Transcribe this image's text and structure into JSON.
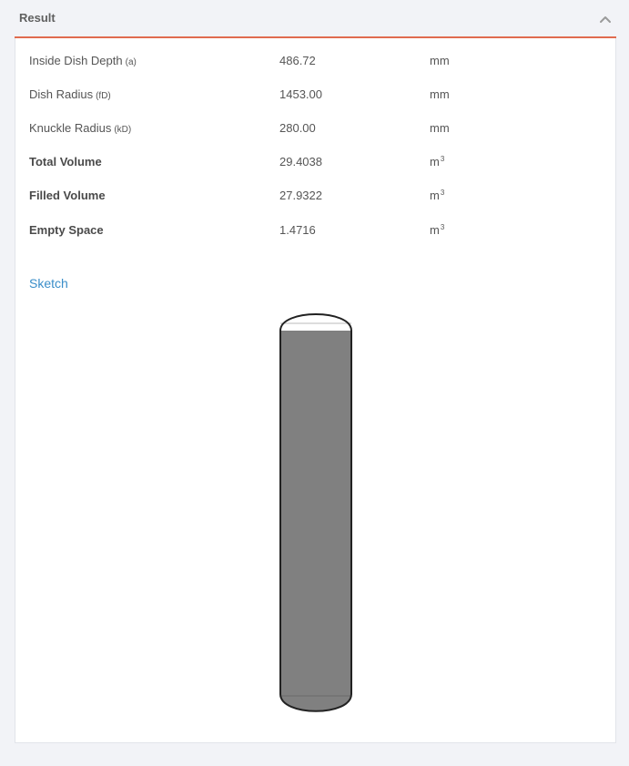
{
  "panel": {
    "title": "Result",
    "collapse_icon": "chevron-up-icon"
  },
  "results": [
    {
      "label": "Inside Dish Depth",
      "symbol": "(a)",
      "value": "486.72",
      "unit": "mm",
      "unit_sup": ""
    },
    {
      "label": "Dish Radius",
      "symbol": "(fD)",
      "value": "1453.00",
      "unit": "mm",
      "unit_sup": ""
    },
    {
      "label": "Knuckle Radius",
      "symbol": "(kD)",
      "value": "280.00",
      "unit": "mm",
      "unit_sup": ""
    },
    {
      "label": "Total Volume",
      "symbol": "",
      "value": "29.4038",
      "unit": "m",
      "unit_sup": "3"
    },
    {
      "label": "Filled Volume",
      "symbol": "",
      "value": "27.9322",
      "unit": "m",
      "unit_sup": "3"
    },
    {
      "label": "Empty Space",
      "symbol": "",
      "value": "1.4716",
      "unit": "m",
      "unit_sup": "3"
    }
  ],
  "sketch": {
    "title": "Sketch",
    "fill_level": 0.95,
    "fill_color": "#808080",
    "outline_color": "#222222"
  },
  "colors": {
    "accent_line": "#e06b4f",
    "link": "#3a8ec9",
    "background": "#f2f3f7"
  }
}
